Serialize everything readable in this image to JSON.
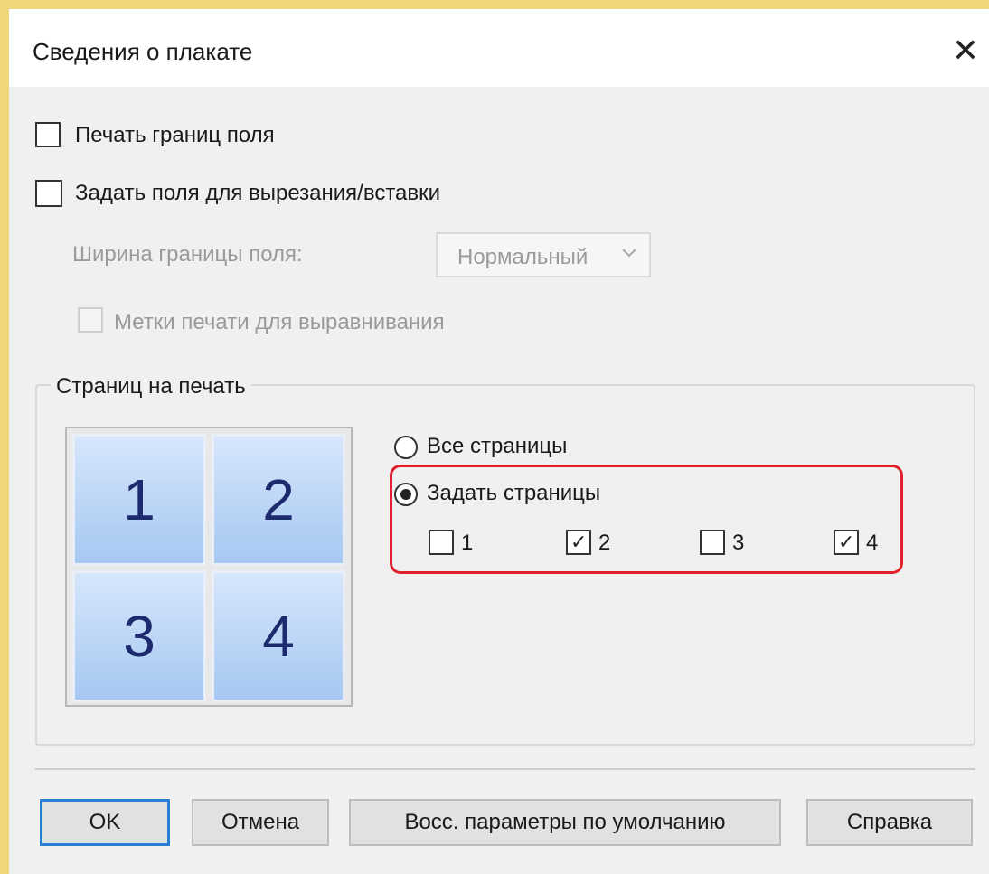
{
  "dialog": {
    "title": "Сведения о плакате",
    "close_glyph": "✕"
  },
  "options": {
    "print_borders_label": "Печать границ поля",
    "print_borders_checked": false,
    "set_margins_label": "Задать поля для вырезания/вставки",
    "set_margins_checked": false,
    "border_width_label": "Ширина границы поля:",
    "border_width_value": "Нормальный",
    "align_marks_label": "Метки печати для выравнивания",
    "align_marks_checked": false
  },
  "pages_group": {
    "title": "Страниц на печать",
    "tiles": [
      "1",
      "2",
      "3",
      "4"
    ],
    "all_pages_label": "Все страницы",
    "all_pages_selected": false,
    "set_pages_label": "Задать страницы",
    "set_pages_selected": true,
    "page_checks": [
      {
        "label": "1",
        "checked": false
      },
      {
        "label": "2",
        "checked": true
      },
      {
        "label": "3",
        "checked": false
      },
      {
        "label": "4",
        "checked": true
      }
    ],
    "check_glyph": "✓"
  },
  "buttons": {
    "ok": "OK",
    "cancel": "Отмена",
    "restore_defaults": "Восс. параметры по умолчанию",
    "help": "Справка"
  },
  "colors": {
    "highlight": "#e0202a",
    "default_button_border": "#2a7fd4",
    "tile_text": "#1d2a6e"
  },
  "icons": {
    "close": "close-icon",
    "dropdown": "chevron-down-icon"
  }
}
